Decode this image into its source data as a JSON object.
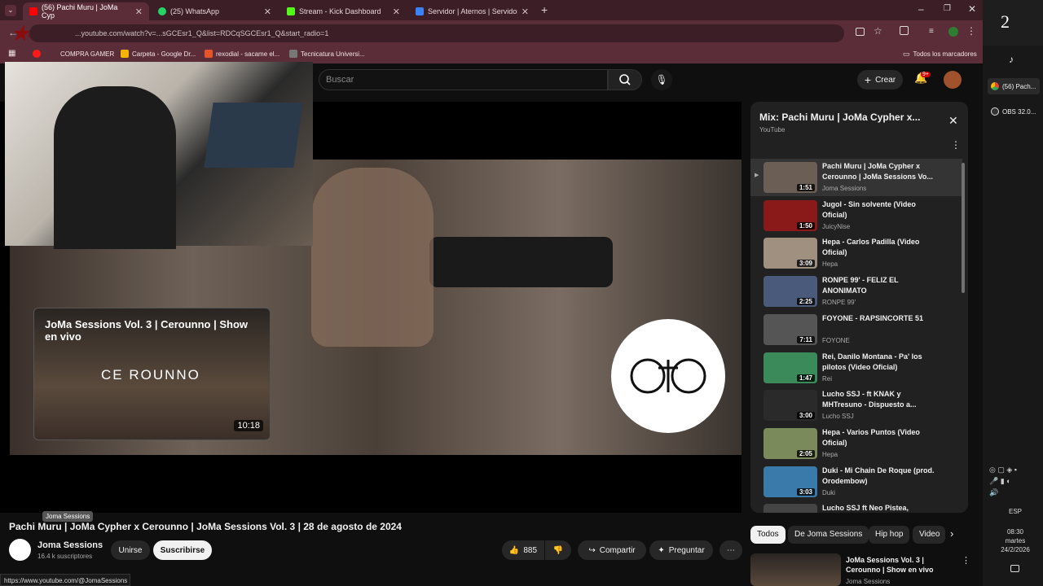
{
  "tabs": [
    {
      "label": "(56) Pachi Muru | JoMa Cyp",
      "active": true,
      "color": "#ff0000"
    },
    {
      "label": "(25) WhatsApp",
      "active": false,
      "color": "#25d366"
    },
    {
      "label": "Stream - Kick Dashboard",
      "active": false,
      "color": "#53fc18"
    },
    {
      "label": "Servidor | Aternos | Servidor de",
      "active": false,
      "color": "#3b82f6"
    }
  ],
  "url": "...youtube.com/watch?v=...sGCEsr1_Q&list=RDCqSGCEsr1_Q&start_radio=1",
  "bookmarks": [
    "COMPRA GAMER",
    "Carpeta - Google Dr...",
    "rexodial - sacame el...",
    "Tecnicatura Universi..."
  ],
  "bookmarks_right": "Todos los marcadores",
  "overlay_number": "2",
  "youtube": {
    "search_placeholder": "Buscar",
    "create_label": "Crear",
    "notif_count": "9+",
    "video_title": "Pachi Muru | JoMa Cypher x Cerounno | JoMa Sessions Vol. 3 | 28 de agosto de 2024",
    "channel": "Joma Sessions",
    "subs": "16.4 k suscriptores",
    "tooltip": "Joma Sessions",
    "join": "Unirse",
    "subscribe": "Suscribirse",
    "likes": "885",
    "share": "Compartir",
    "ask": "Preguntar",
    "endcard_title": "JoMa Sessions Vol. 3 | Cerounno | Show en vivo",
    "endcard_text": "CE ROUNNO",
    "endcard_duration": "10:18",
    "mix_title": "Mix: Pachi Muru | JoMa Cypher x...",
    "mix_sub": "YouTube",
    "mix_items": [
      {
        "title": "Pachi Muru | JoMa Cypher x Cerounno | JoMa Sessions Vo...",
        "channel": "Joma Sessions",
        "dur": "1:51",
        "color": "#6b5e55"
      },
      {
        "title": "Jugol - Sin solvente (Video Oficial)",
        "channel": "JuicyNise",
        "dur": "1:50",
        "color": "#8a1a1a"
      },
      {
        "title": "Hepa - Carlos Padilla (Video Oficial)",
        "channel": "Hepa",
        "dur": "3:09",
        "color": "#a09080"
      },
      {
        "title": "RONPE 99' - FELIZ EL ANONIMATO",
        "channel": "RONPE 99'",
        "dur": "2:25",
        "color": "#4a5a7a"
      },
      {
        "title": "FOYONE - RAPSINCORTE 51",
        "channel": "FOYONE",
        "dur": "7:11",
        "color": "#555"
      },
      {
        "title": "Rei, Danilo Montana - Pa' los pilotos (Video Oficial)",
        "channel": "Rei",
        "dur": "1:47",
        "color": "#3a8a5a"
      },
      {
        "title": "Lucho SSJ - ft KNAK y MHTresuno - Dispuesto a...",
        "channel": "Lucho SSJ",
        "dur": "3:00",
        "color": "#2a2a2a"
      },
      {
        "title": "Hepa - Varios Puntos (Video Oficial)",
        "channel": "Hepa",
        "dur": "2:05",
        "color": "#7a8a5a"
      },
      {
        "title": "Duki - Mi Chain De Roque (prod. Orodembow)",
        "channel": "Duki",
        "dur": "3:03",
        "color": "#3a7aaa"
      },
      {
        "title": "Lucho SSJ ft Neo Pistea,",
        "channel": "",
        "dur": "",
        "color": "#444"
      }
    ],
    "chips": [
      "Todos",
      "De Joma Sessions",
      "Hip hop",
      "Video"
    ],
    "rec_title": "JoMa Sessions Vol. 3 | Cerounno | Show en vivo",
    "rec_channel": "Joma Sessions"
  },
  "taskbar": {
    "items": [
      "(56) Pach...",
      "OBS 32.0..."
    ],
    "lang": "ESP",
    "time": "08:30",
    "day": "martes",
    "date": "24/2/2026"
  },
  "statusbar": "https://www.youtube.com/@JomaSessions"
}
